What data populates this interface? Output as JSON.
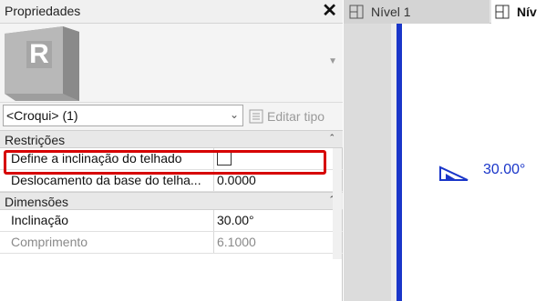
{
  "panel": {
    "title": "Propriedades",
    "close_label": "✕",
    "type_selector": {
      "value": "<Croqui> (1)"
    },
    "edit_type_label": "Editar tipo"
  },
  "sections": [
    {
      "label": "Restrições",
      "rows": [
        {
          "name": "Define a inclinação do telhado",
          "value": "",
          "checkbox": true,
          "highlighted": true
        },
        {
          "name": "Deslocamento da base do telha...",
          "value": "0.0000"
        }
      ]
    },
    {
      "label": "Dimensões",
      "rows": [
        {
          "name": "Inclinação",
          "value": "30.00°"
        },
        {
          "name": "Comprimento",
          "value": "6.1000",
          "disabled": true
        }
      ]
    }
  ],
  "tabs": [
    {
      "label": "Nível 1"
    },
    {
      "label": "Nív"
    }
  ],
  "view": {
    "slope_label": "30.00°"
  },
  "colors": {
    "highlight": "#d60000",
    "view_blue": "#1a36c9"
  },
  "icons": {
    "type_thumbnail": "revit-r-icon",
    "edit_type": "edit-type-icon",
    "tab": "plan-view-icon",
    "slope": "slope-arrow-icon"
  }
}
